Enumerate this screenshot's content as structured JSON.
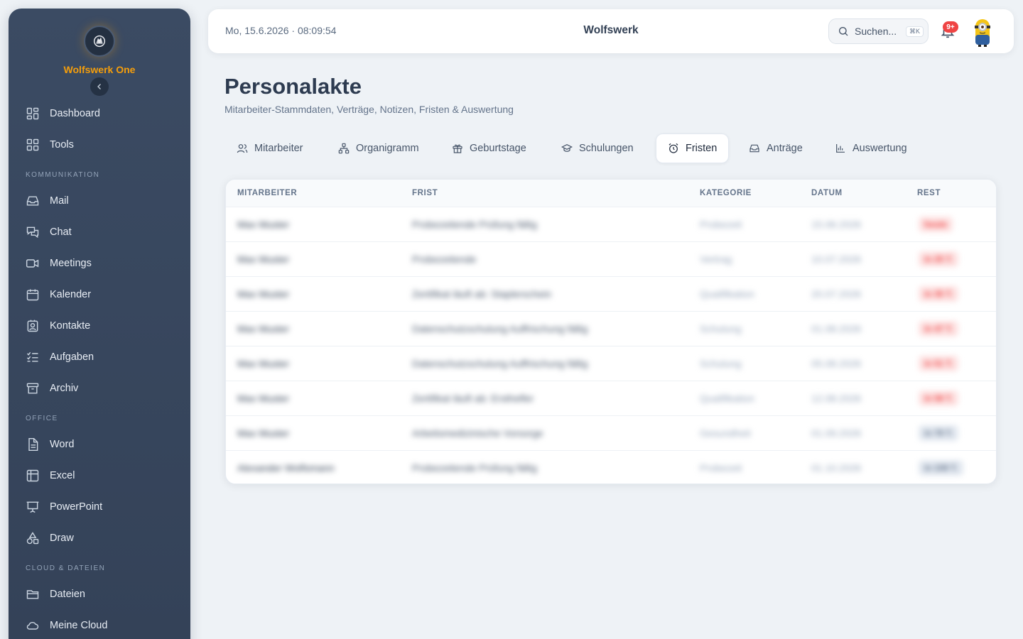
{
  "sidebar": {
    "brand": "Wolfswerk One",
    "items": [
      {
        "label": "Dashboard",
        "icon": "dashboard-icon"
      },
      {
        "label": "Tools",
        "icon": "grid-icon"
      },
      {
        "label": "Mail",
        "icon": "inbox-icon"
      },
      {
        "label": "Chat",
        "icon": "chat-icon"
      },
      {
        "label": "Meetings",
        "icon": "video-icon"
      },
      {
        "label": "Kalender",
        "icon": "calendar-icon"
      },
      {
        "label": "Kontakte",
        "icon": "contact-icon"
      },
      {
        "label": "Aufgaben",
        "icon": "tasks-icon"
      },
      {
        "label": "Archiv",
        "icon": "archive-icon"
      },
      {
        "label": "Word",
        "icon": "document-icon"
      },
      {
        "label": "Excel",
        "icon": "table-icon"
      },
      {
        "label": "PowerPoint",
        "icon": "presentation-icon"
      },
      {
        "label": "Draw",
        "icon": "shapes-icon"
      },
      {
        "label": "Dateien",
        "icon": "folder-icon"
      },
      {
        "label": "Meine Cloud",
        "icon": "cloud-icon"
      }
    ],
    "sections": [
      "KOMMUNIKATION",
      "OFFICE",
      "CLOUD & DATEIEN"
    ]
  },
  "topbar": {
    "datetime": "Mo, 15.6.2026 · 08:09:54",
    "workspace": "Wolfswerk",
    "search_placeholder": "Suchen...",
    "search_shortcut": "⌘K",
    "notification_badge": "9+"
  },
  "page": {
    "title": "Personalakte",
    "subtitle": "Mitarbeiter-Stammdaten, Verträge, Notizen, Fristen & Auswertung"
  },
  "tabs": [
    {
      "label": "Mitarbeiter",
      "icon": "users-icon"
    },
    {
      "label": "Organigramm",
      "icon": "org-chart-icon"
    },
    {
      "label": "Geburtstage",
      "icon": "gift-icon"
    },
    {
      "label": "Schulungen",
      "icon": "graduation-cap-icon"
    },
    {
      "label": "Fristen",
      "icon": "alarm-clock-icon",
      "active": true
    },
    {
      "label": "Anträge",
      "icon": "inbox-icon"
    },
    {
      "label": "Auswertung",
      "icon": "bar-chart-icon"
    }
  ],
  "table": {
    "columns": [
      "MITARBEITER",
      "FRIST",
      "KATEGORIE",
      "DATUM",
      "REST"
    ],
    "rows": [
      {
        "mitarbeiter": "Max Muster",
        "frist": "Probezeitende Prüfung fällig",
        "kategorie": "Probezeit",
        "datum": "15.06.2026",
        "rest": "heute",
        "status": "red"
      },
      {
        "mitarbeiter": "Max Muster",
        "frist": "Probezeitende",
        "kategorie": "Vertrag",
        "datum": "10.07.2026",
        "rest": "in 25 T.",
        "status": "red"
      },
      {
        "mitarbeiter": "Max Muster",
        "frist": "Zertifikat läuft ab: Staplerschein",
        "kategorie": "Qualifikation",
        "datum": "20.07.2026",
        "rest": "in 35 T.",
        "status": "red"
      },
      {
        "mitarbeiter": "Max Muster",
        "frist": "Datenschutzschulung Auffrischung fällig",
        "kategorie": "Schulung",
        "datum": "01.08.2026",
        "rest": "in 47 T.",
        "status": "red"
      },
      {
        "mitarbeiter": "Max Muster",
        "frist": "Datenschutzschulung Auffrischung fällig",
        "kategorie": "Schulung",
        "datum": "05.08.2026",
        "rest": "in 51 T.",
        "status": "red"
      },
      {
        "mitarbeiter": "Max Muster",
        "frist": "Zertifikat läuft ab: Ersthelfer",
        "kategorie": "Qualifikation",
        "datum": "12.08.2026",
        "rest": "in 58 T.",
        "status": "red"
      },
      {
        "mitarbeiter": "Max Muster",
        "frist": "Arbeitsmedizinische Vorsorge",
        "kategorie": "Gesundheit",
        "datum": "01.09.2026",
        "rest": "in 78 T.",
        "status": "gray"
      },
      {
        "mitarbeiter": "Alexander Wolfsmann",
        "frist": "Probezeitende Prüfung fällig",
        "kategorie": "Probezeit",
        "datum": "01.10.2026",
        "rest": "in 108 T.",
        "status": "gray"
      }
    ]
  },
  "colors": {
    "brand": "#f59e0b",
    "sidebar": "#3b4b63",
    "danger": "#ef4444"
  }
}
